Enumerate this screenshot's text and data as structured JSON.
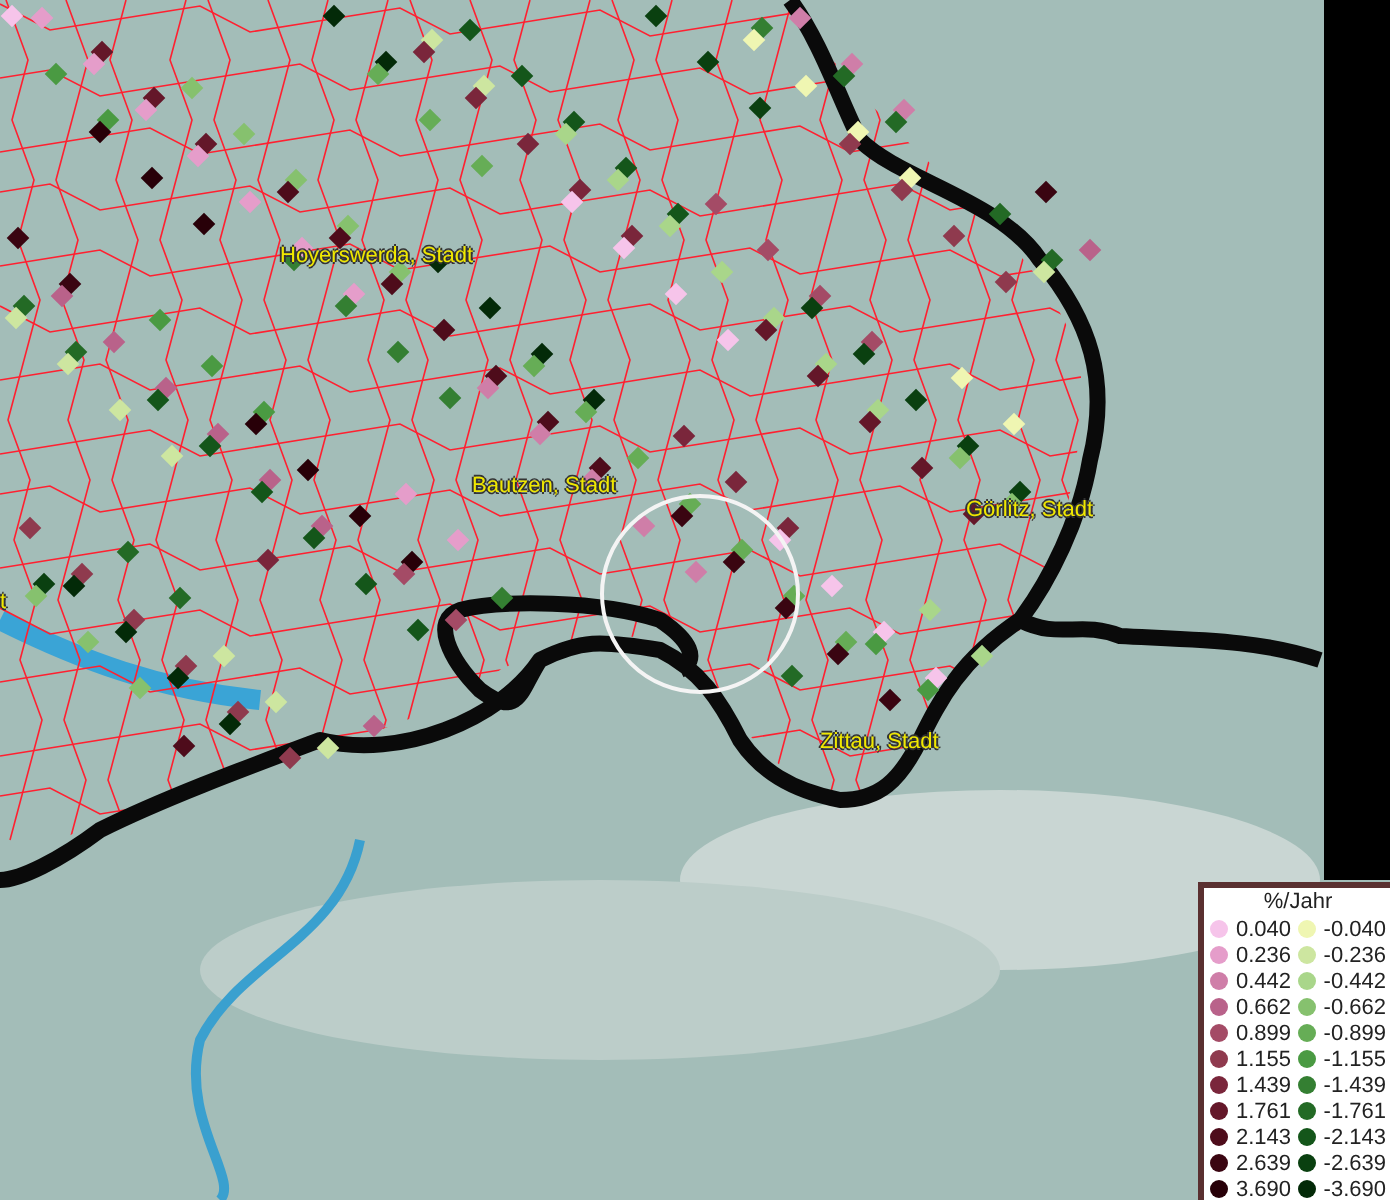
{
  "map": {
    "places": [
      {
        "label": "Hoyerswerda, Stadt"
      },
      {
        "label": "Bautzen, Stadt"
      },
      {
        "label": "Görlitz, Stadt"
      },
      {
        "label": "Zittau, Stadt"
      },
      {
        "label": "t"
      }
    ]
  },
  "legend": {
    "title": "%/Jahr",
    "increase": [
      {
        "label": "0.040",
        "color": "#f6c4ea"
      },
      {
        "label": "0.236",
        "color": "#e59dca"
      },
      {
        "label": "0.442",
        "color": "#cf7ea8"
      },
      {
        "label": "0.662",
        "color": "#b9628a"
      },
      {
        "label": "0.899",
        "color": "#a44b66"
      },
      {
        "label": "1.155",
        "color": "#8f3a4e"
      },
      {
        "label": "1.439",
        "color": "#7a263b"
      },
      {
        "label": "1.761",
        "color": "#641729"
      },
      {
        "label": "2.143",
        "color": "#4e0c1b"
      },
      {
        "label": "2.639",
        "color": "#3a0511"
      },
      {
        "label": "3.690",
        "color": "#280008"
      }
    ],
    "decrease": [
      {
        "label": "-0.040",
        "color": "#eff6b2"
      },
      {
        "label": "-0.236",
        "color": "#cde6a0"
      },
      {
        "label": "-0.442",
        "color": "#a9d68a"
      },
      {
        "label": "-0.662",
        "color": "#86c16e"
      },
      {
        "label": "-0.899",
        "color": "#66ad56"
      },
      {
        "label": "-1.155",
        "color": "#4a9a42"
      },
      {
        "label": "-1.439",
        "color": "#347f32"
      },
      {
        "label": "-1.761",
        "color": "#236a25"
      },
      {
        "label": "-2.143",
        "color": "#14561a"
      },
      {
        "label": "-2.639",
        "color": "#0a4010"
      },
      {
        "label": "-3.690",
        "color": "#032a08"
      }
    ]
  }
}
